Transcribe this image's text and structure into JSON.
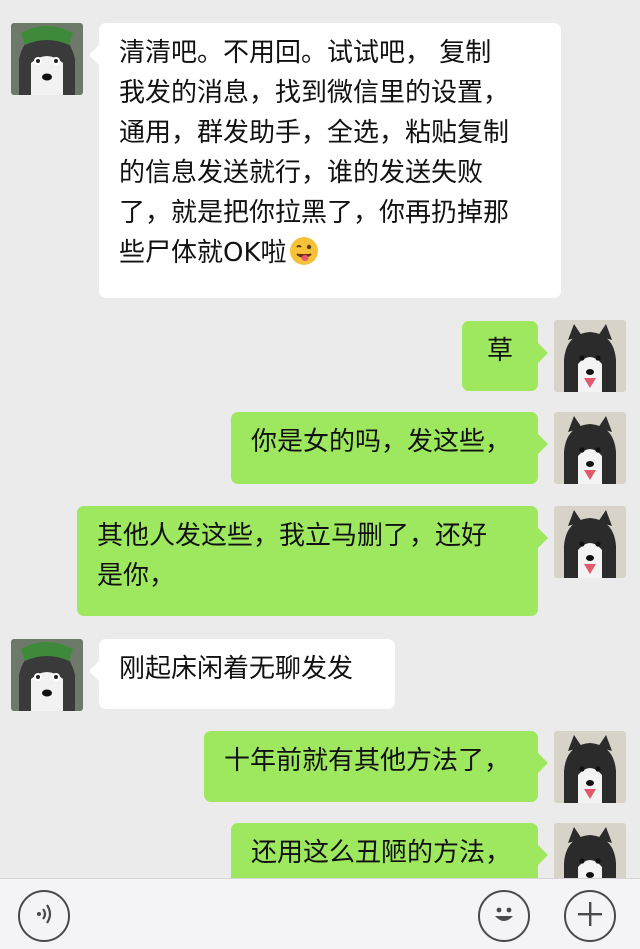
{
  "messages": [
    {
      "side": "left",
      "text_lines": [
        "清清吧。不用回。试试吧， 复制",
        "我发的消息，找到微信里的设置，",
        "通用，群发助手，全选，粘贴复制",
        "的信息发送就行，谁的发送失败",
        "了，就是把你拉黑了，你再扔掉那",
        "些尸体就OK啦"
      ],
      "emoji": "winking-tongue-emoji"
    },
    {
      "side": "right",
      "text": "草"
    },
    {
      "side": "right",
      "text": "你是女的吗，发这些，"
    },
    {
      "side": "right",
      "text_lines": [
        "其他人发这些，我立马删了，还好",
        "是你，"
      ]
    },
    {
      "side": "left",
      "text": "刚起床闲着无聊发发"
    },
    {
      "side": "right",
      "text": "十年前就有其他方法了，"
    },
    {
      "side": "right",
      "text": "还用这么丑陋的方法，"
    }
  ],
  "avatars": {
    "left": "husky-avatar",
    "right": "husky-puppy-avatar"
  },
  "input_bar": {
    "voice_icon": "voice-icon",
    "emoji_icon": "emoji-smile-icon",
    "plus_icon": "plus-icon"
  },
  "colors": {
    "background": "#ebebeb",
    "sent_bubble": "#9ee85f",
    "received_bubble": "#ffffff"
  }
}
